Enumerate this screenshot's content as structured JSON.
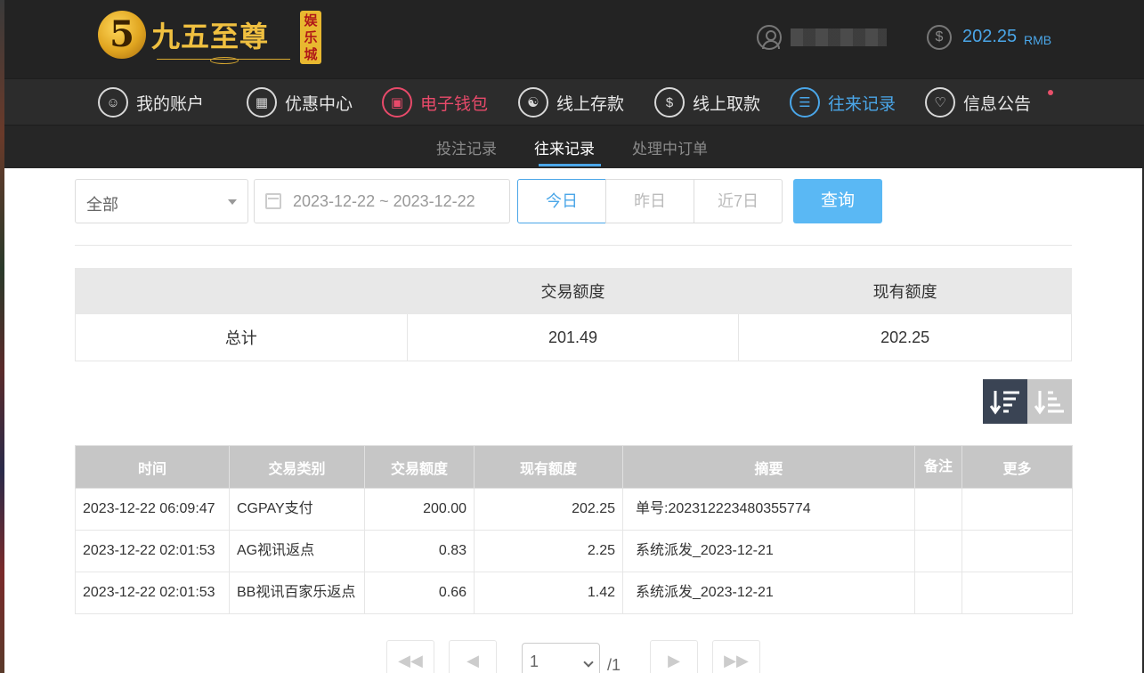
{
  "header": {
    "logo": {
      "numeral": "5",
      "name": "九五至尊",
      "badge": "娱乐城"
    },
    "balance": {
      "value": "202.25",
      "unit": "RMB"
    }
  },
  "main_nav": [
    {
      "label": "我的账户",
      "icon": "user-icon"
    },
    {
      "label": "优惠中心",
      "icon": "gift-icon"
    },
    {
      "label": "电子钱包",
      "icon": "wallet-icon"
    },
    {
      "label": "线上存款",
      "icon": "deposit-icon"
    },
    {
      "label": "线上取款",
      "icon": "withdraw-icon"
    },
    {
      "label": "往来记录",
      "icon": "records-icon"
    },
    {
      "label": "信息公告",
      "icon": "bell-icon"
    }
  ],
  "sub_nav": [
    "投注记录",
    "往来记录",
    "处理中订单"
  ],
  "filters": {
    "type_select": "全部",
    "date_range": "2023-12-22 ~ 2023-12-22",
    "ranges": [
      "今日",
      "昨日",
      "近7日"
    ],
    "query_label": "查询"
  },
  "summary": {
    "headers": [
      "",
      "交易额度",
      "现有额度"
    ],
    "row": [
      "总计",
      "201.49",
      "202.25"
    ]
  },
  "details": {
    "headers": [
      "时间",
      "交易类别",
      "交易额度",
      "现有额度",
      "摘要",
      "备注",
      "更多"
    ],
    "rows": [
      [
        "2023-12-22 06:09:47",
        "CGPAY支付",
        "200.00",
        "202.25",
        "单号:202312223480355774",
        "",
        ""
      ],
      [
        "2023-12-22 02:01:53",
        "AG视讯返点",
        "0.83",
        "2.25",
        "系统派发_2023-12-21",
        "",
        ""
      ],
      [
        "2023-12-22 02:01:53",
        "BB视讯百家乐返点",
        "0.66",
        "1.42",
        "系统派发_2023-12-21",
        "",
        ""
      ]
    ]
  },
  "pagination": {
    "current": "1",
    "total": "/1"
  },
  "colors": {
    "accent_blue": "#4aa6e8",
    "accent_red": "#e84a6a",
    "header_bg": "#232323"
  }
}
